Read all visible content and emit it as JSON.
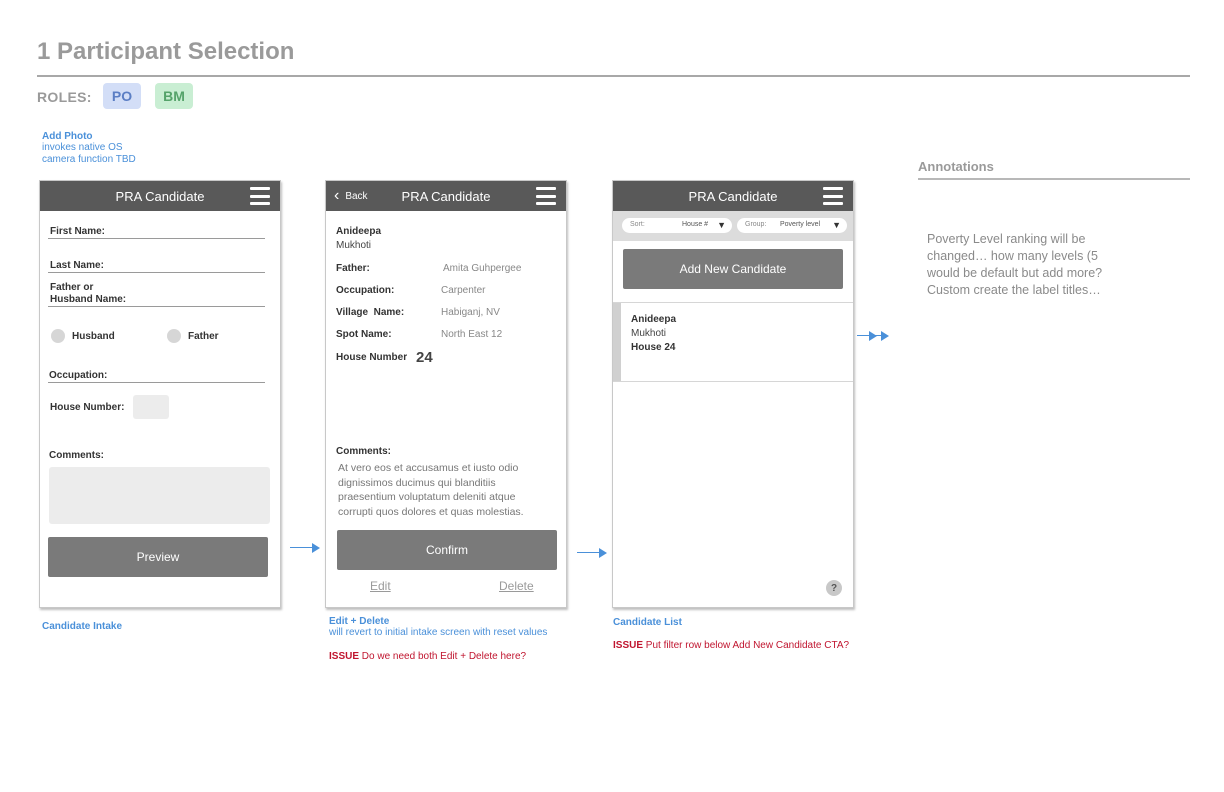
{
  "page": {
    "title": "1 Participant Selection",
    "roles_label": "ROLES:",
    "roles": [
      "PO",
      "BM"
    ]
  },
  "notes": {
    "add_photo": {
      "title": "Add Photo",
      "lines": [
        "invokes native OS",
        "camera function TBD"
      ]
    },
    "candidate_intake": "Candidate Intake",
    "edit_delete": {
      "title": "Edit + Delete",
      "sub": "will revert to initial intake screen with reset values"
    },
    "issue_label": "ISSUE",
    "issue_1": "Do we need both Edit + Delete here?",
    "candidate_list": "Candidate List",
    "issue_2": "Put filter row below Add New Candidate CTA?"
  },
  "screen1": {
    "header": "PRA Candidate",
    "first_name": "First Name:",
    "last_name": "Last Name:",
    "father_or_husband": [
      "Father or",
      "Husband Name:"
    ],
    "radio_husband": "Husband",
    "radio_father": "Father",
    "occupation": "Occupation:",
    "house_number": "House Number:",
    "comments": "Comments:",
    "preview": "Preview"
  },
  "screen2": {
    "back": "Back",
    "header": "PRA Candidate",
    "name_first": "Anideepa",
    "name_last": "Mukhoti",
    "fields": [
      {
        "label": "Father:",
        "value": "Amita Guhpergee"
      },
      {
        "label": "Occupation:",
        "value": "Carpenter"
      },
      {
        "label": "Village  Name:",
        "value": "Habiganj, NV"
      },
      {
        "label": "Spot Name:",
        "value": "North East 12"
      }
    ],
    "house_label": "House Number",
    "house_value": "24",
    "comments_label": "Comments:",
    "comments_lines": [
      "At vero eos et accusamus et iusto odio",
      "dignissimos ducimus qui blanditiis",
      "praesentium voluptatum deleniti atque",
      "corrupti quos dolores et quas molestias."
    ],
    "confirm": "Confirm",
    "edit": "Edit",
    "delete": "Delete"
  },
  "screen3": {
    "header": "PRA Candidate",
    "sort_label": "Sort:",
    "sort_value": "House #",
    "group_label": "Group:",
    "group_value": "Poverty level",
    "add_new": "Add New Candidate",
    "candidate": {
      "first": "Anideepa",
      "last": "Mukhoti",
      "house": "House 24"
    },
    "help": "?"
  },
  "annotations": {
    "title": "Annotations",
    "lines": [
      "Poverty Level ranking will be",
      "changed… how many levels (5",
      "would be default but add more?",
      "Custom create the label titles…"
    ]
  },
  "colors": {
    "note_blue": "#4a90d9",
    "issue_red": "#c0152f",
    "header_gray": "#595959",
    "button_gray": "#7a7a7a"
  }
}
